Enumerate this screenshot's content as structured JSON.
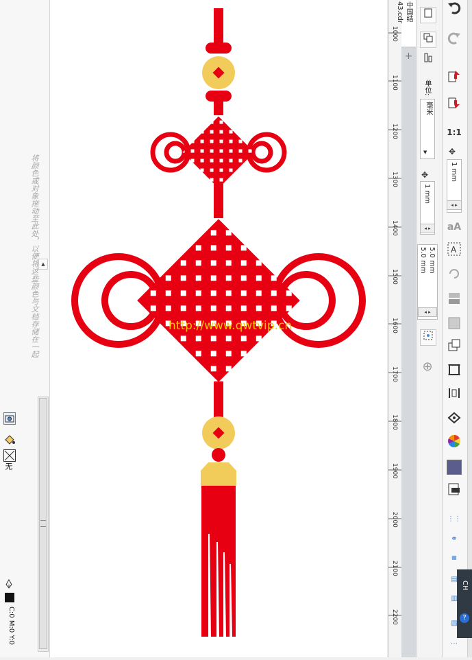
{
  "left_panel": {
    "hint_text": "将颜色或对象拖动至此处，以便将这些颜色与文档存储在一起",
    "scroll_up_glyph": "▲",
    "fill_none_label": "无",
    "status_text": "C:0 M:0 Y:0",
    "icons": [
      "color-docker-icon",
      "fill-icon",
      "no-fill-icon",
      "pen-icon",
      "color-swatch-icon"
    ]
  },
  "canvas": {
    "watermark": "http://www.qwtvip.cn",
    "artwork": "chinese-knot",
    "colors": {
      "knot_red": "#e60012",
      "gold": "#f2cc5b",
      "tassel_red": "#e60012"
    }
  },
  "ruler": {
    "labels": [
      "1000",
      "1100",
      "1200",
      "1300",
      "1400",
      "1500",
      "1600",
      "1700",
      "1800",
      "1900",
      "2000",
      "2100",
      "2200"
    ]
  },
  "doc_tab": {
    "title": "中国结43.cdr",
    "add_glyph": "+"
  },
  "property_bar": {
    "units_label": "单位:",
    "units_value": "毫米",
    "nudge_value": "1 mm",
    "dup_x": "5.0 mm",
    "dup_y": "5.0 mm"
  },
  "toolbox": {
    "nudge_value": "1 mm",
    "zoom_ratio": "1:1",
    "ime_label": "CH"
  }
}
